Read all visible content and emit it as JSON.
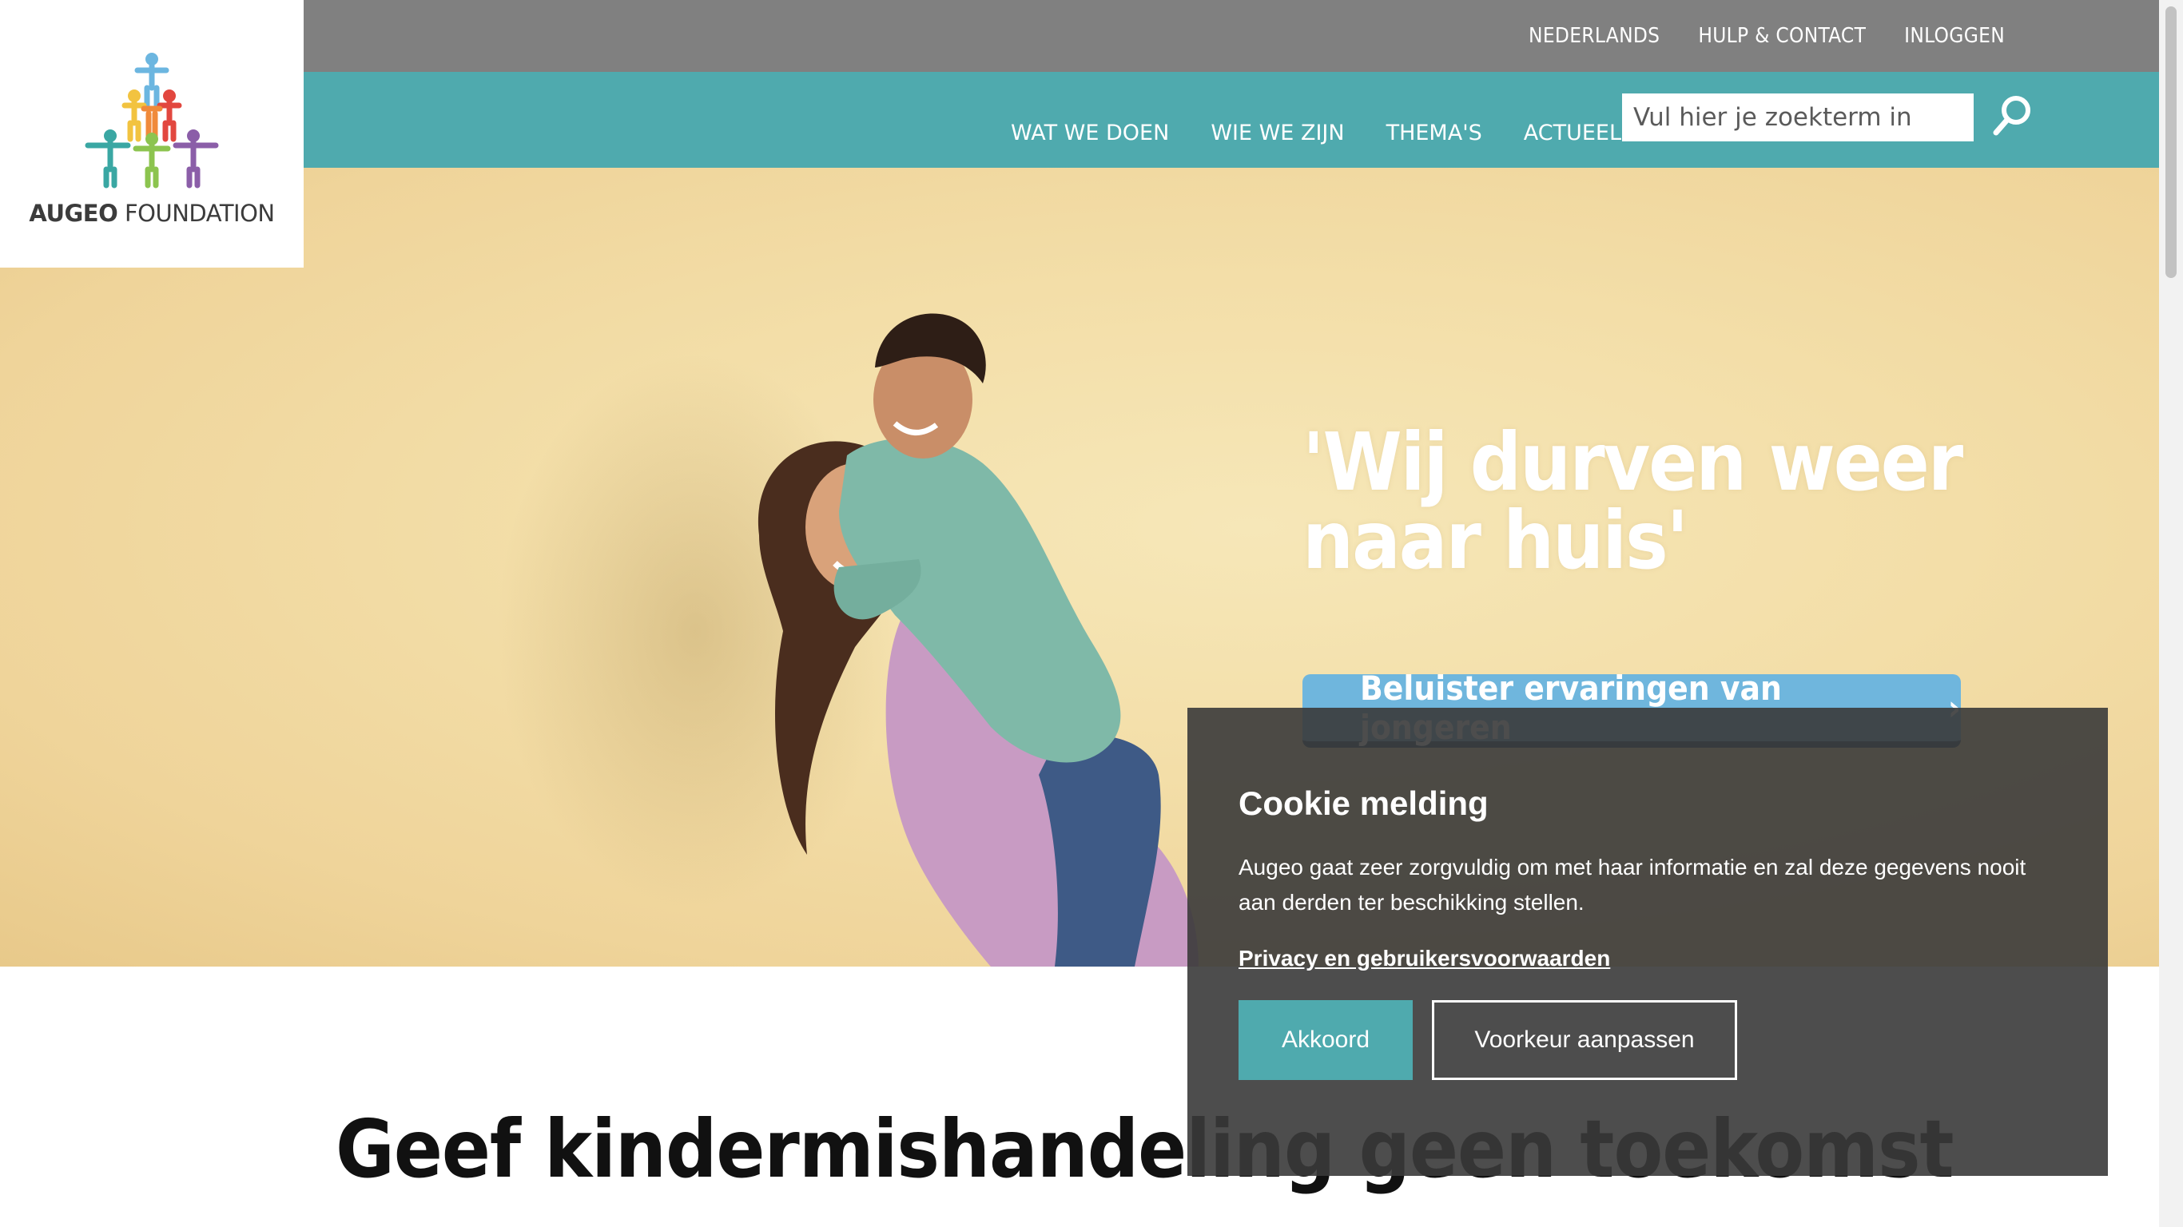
{
  "logo": {
    "brand_bold": "AUGEO",
    "brand_rest": " FOUNDATION"
  },
  "topbar": {
    "items": [
      "NEDERLANDS",
      "HULP & CONTACT",
      "INLOGGEN"
    ]
  },
  "nav": {
    "items": [
      "WAT WE DOEN",
      "WIE WE ZIJN",
      "THEMA'S",
      "ACTUEEL"
    ],
    "search_placeholder": "Vul hier je zoekterm in"
  },
  "hero": {
    "quote_line1": "'Wij durven weer",
    "quote_line2": "naar huis'",
    "cta_label": "Beluister ervaringen van jongeren"
  },
  "page": {
    "title": "Geef kindermishandeling geen toekomst"
  },
  "cookie": {
    "title": "Cookie melding",
    "body": "Augeo gaat zeer zorgvuldig om met haar informatie en zal deze gegevens nooit aan derden ter beschikking stellen.",
    "link": "Privacy en gebruikersvoorwaarden",
    "accept_label": "Akkoord",
    "prefs_label": "Voorkeur aanpassen"
  },
  "colors": {
    "teal": "#4faaae",
    "topbar_gray": "#808080",
    "cta_blue": "#6fb6dd",
    "modal_bg": "#3a3a3a"
  }
}
